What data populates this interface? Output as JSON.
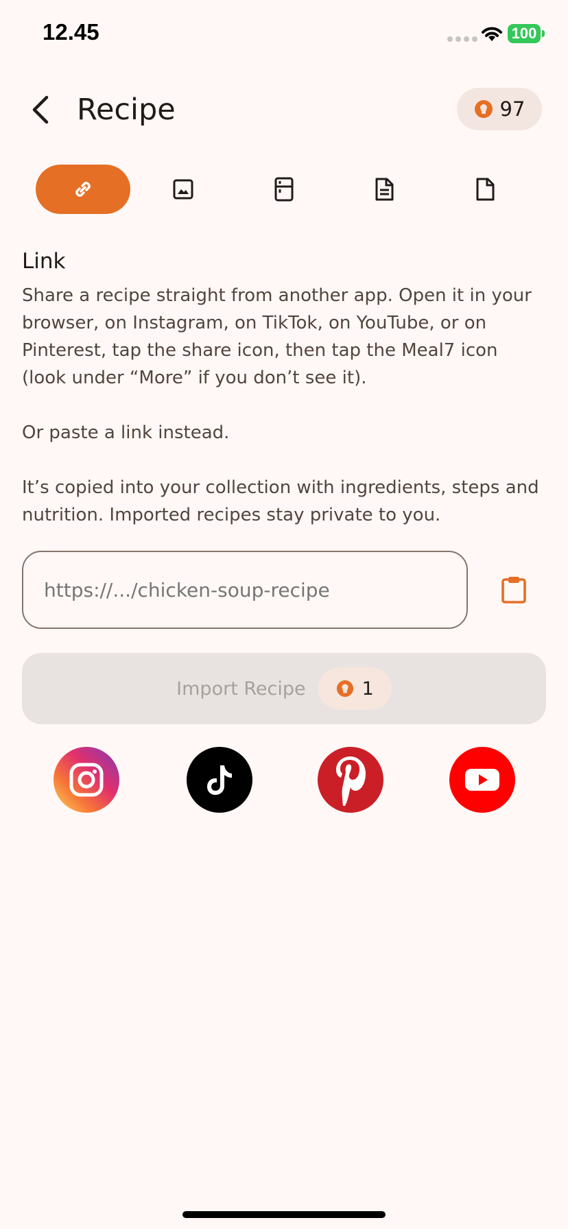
{
  "status_bar": {
    "time": "12.45",
    "battery": "100"
  },
  "header": {
    "title": "Recipe",
    "credits": "97"
  },
  "tabs": [
    {
      "icon": "link-icon",
      "active": true
    },
    {
      "icon": "image-icon",
      "active": false
    },
    {
      "icon": "fridge-icon",
      "active": false
    },
    {
      "icon": "document-lines-icon",
      "active": false
    },
    {
      "icon": "file-icon",
      "active": false
    }
  ],
  "link_section": {
    "heading": "Link",
    "paragraph_1": "Share a recipe straight from another app. Open it in your browser, on Instagram, on TikTok, on YouTube, or on Pinterest, tap the share icon, then tap the Meal7 icon (look under “More” if you don’t see it).",
    "paragraph_2": "Or paste a link instead.",
    "paragraph_3": "It’s copied into your collection with ingredients, steps and nutrition. Imported recipes stay private to you."
  },
  "url_input": {
    "placeholder": "https://.../chicken-soup-recipe",
    "value": ""
  },
  "import_button": {
    "label": "Import Recipe",
    "cost": "1"
  },
  "social_sources": [
    "instagram-icon",
    "tiktok-icon",
    "pinterest-icon",
    "youtube-icon"
  ],
  "colors": {
    "accent": "#e56f25",
    "background": "#fff8f6",
    "chip": "#f3e6e0",
    "disabled_button": "#e8e3e0"
  }
}
